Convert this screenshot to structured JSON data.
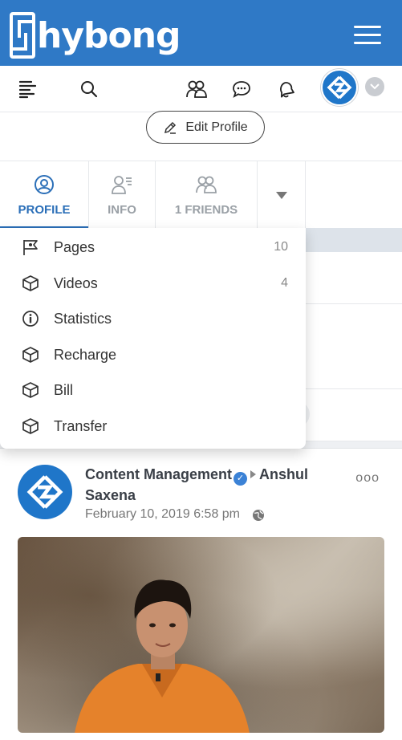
{
  "brand": {
    "name": "hybong",
    "logo_letter": "S"
  },
  "edit_profile": {
    "label": "Edit Profile"
  },
  "tabs": [
    {
      "label": "PROFILE",
      "icon": "user-circle-icon",
      "active": true
    },
    {
      "label": "INFO",
      "icon": "user-info-icon",
      "active": false
    },
    {
      "label": "1 FRIENDS",
      "icon": "friends-icon",
      "active": false
    }
  ],
  "dropdown": {
    "items": [
      {
        "label": "Pages",
        "icon": "flag-icon",
        "count": "10"
      },
      {
        "label": "Videos",
        "icon": "cube-icon",
        "count": "4"
      },
      {
        "label": "Statistics",
        "icon": "info-icon",
        "count": ""
      },
      {
        "label": "Recharge",
        "icon": "cube-icon",
        "count": ""
      },
      {
        "label": "Bill",
        "icon": "cube-icon",
        "count": ""
      },
      {
        "label": "Transfer",
        "icon": "cube-icon",
        "count": ""
      }
    ]
  },
  "post": {
    "author": "Content Management",
    "target": "Anshul Saxena",
    "date": "February 10, 2019 6:58 pm",
    "more": "ooo"
  },
  "colors": {
    "brand_blue": "#2f79c6",
    "accent": "#2b6fb8"
  }
}
